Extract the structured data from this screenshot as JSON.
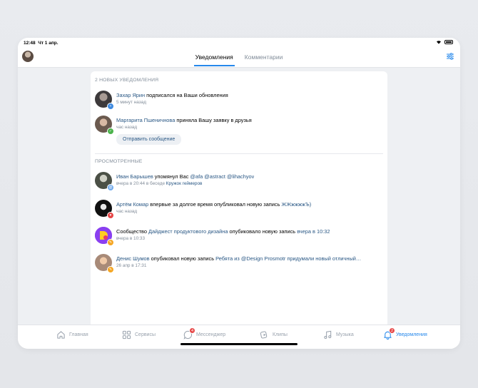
{
  "status": {
    "time": "12:48",
    "date": "Чт 1 апр."
  },
  "header": {
    "tabs": [
      "Уведомления",
      "Комментарии"
    ]
  },
  "new_section": {
    "title": "2 НОВЫХ УВЕДОМЛЕНИЯ"
  },
  "viewed_section": {
    "title": "ПРОСМОТРЕННЫЕ"
  },
  "notifications": [
    {
      "name": "Захар Ярин",
      "text": " подписался на Ваши  обновления",
      "time": "5 минут назад",
      "badge_color": "#3f8ae0",
      "badge_glyph": "+"
    },
    {
      "name": "Маргарита Пшеничнова",
      "text": " приняла Вашу заявку в друзья",
      "time": "час назад",
      "button": "Отправить сообщение",
      "badge_color": "#4bb34b",
      "badge_glyph": "✓"
    },
    {
      "name": "Иван Барышев",
      "text": " упомянул Вас ",
      "mentions": "@afa @astract @lihachyov",
      "time": "вчера в 20:44 в беседе ",
      "time_link": "Кружок геймеров",
      "badge_color": "#71aaeb",
      "badge_glyph": "@"
    },
    {
      "name": "Артём Комар",
      "text": " впервые за долгое время опубликовал новую запись ",
      "tail_link": "ЖЖжжжжЪ)",
      "time": "час назад",
      "badge_color": "#e64646",
      "badge_glyph": "♥"
    },
    {
      "prefix": "Сообщество ",
      "name": "Дайджест продуктового дизайна",
      "text": " опубиковало новую запись ",
      "tail_link": "вчера в 10:32",
      "time": "вчера в 10:33",
      "badge_color": "#f5a623",
      "badge_glyph": "✎"
    },
    {
      "name": "Денис Шумов",
      "text": " опубиковал новую запись ",
      "tail_link": "Ребята из @Design Prosmotr придумали новый отличный…",
      "time": "26 апр в 17:31",
      "badge_color": "#f5a623",
      "badge_glyph": "✎"
    }
  ],
  "tabbar": [
    {
      "label": "Главная",
      "icon": "home-icon"
    },
    {
      "label": "Сервисы",
      "icon": "services-icon"
    },
    {
      "label": "Мессенджер",
      "icon": "messenger-icon",
      "count": "4"
    },
    {
      "label": "Клипы",
      "icon": "clips-icon"
    },
    {
      "label": "Музыка",
      "icon": "music-icon"
    },
    {
      "label": "Уведомления",
      "icon": "bell-icon",
      "count": "2",
      "active": true
    }
  ],
  "colors": {
    "accent": "#2688eb",
    "link": "#2a5885",
    "secondary": "#818c99"
  }
}
